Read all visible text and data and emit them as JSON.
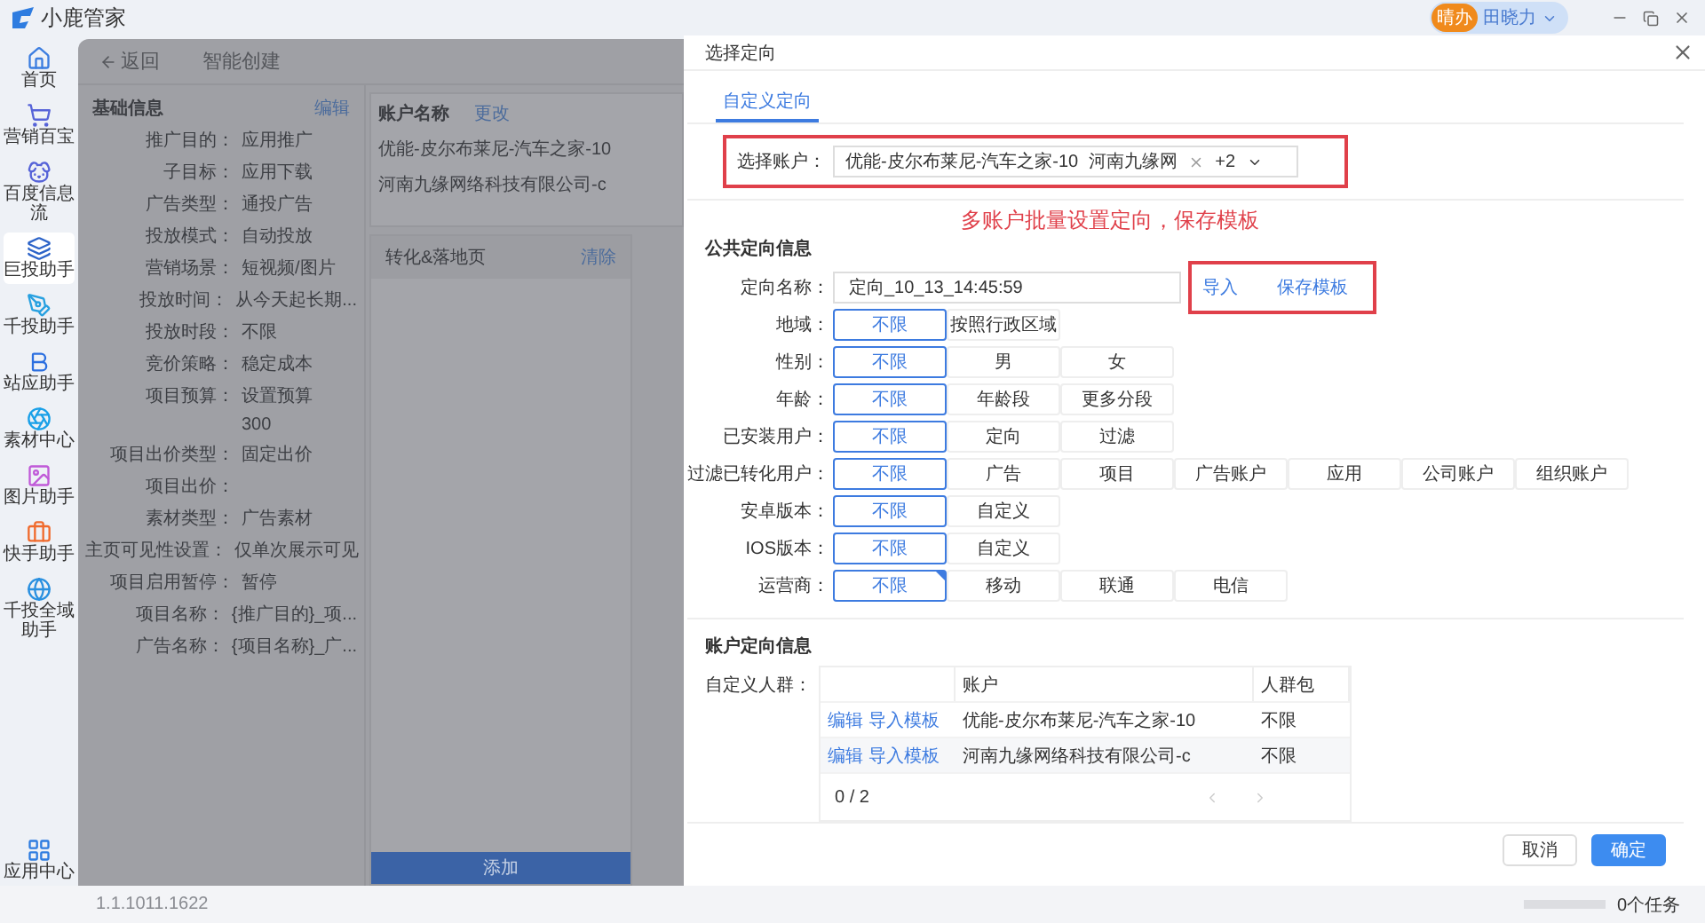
{
  "app": {
    "name": "小鹿管家",
    "user": {
      "avatar_text": "晴办",
      "name": "田晓力"
    }
  },
  "sidebar": {
    "items": [
      {
        "label": "首页",
        "selected": false
      },
      {
        "label": "营销百宝",
        "selected": false
      },
      {
        "label": "百度信息流",
        "selected": false
      },
      {
        "label": "巨投助手",
        "selected": true
      },
      {
        "label": "千投助手",
        "selected": false
      },
      {
        "label": "站应助手",
        "selected": false
      },
      {
        "label": "素材中心",
        "selected": false
      },
      {
        "label": "图片助手",
        "selected": false
      },
      {
        "label": "快手助手",
        "selected": false
      },
      {
        "label": "千投全域助手",
        "selected": false
      }
    ],
    "bottom_item": {
      "label": "应用中心"
    }
  },
  "background_page": {
    "back": "返回",
    "title": "智能创建",
    "basic_info": {
      "title": "基础信息",
      "action": "编辑",
      "rows": [
        {
          "label": "推广目的：",
          "value": "应用推广"
        },
        {
          "label": "子目标：",
          "value": "应用下载"
        },
        {
          "label": "广告类型：",
          "value": "通投广告"
        },
        {
          "label": "投放模式：",
          "value": "自动投放"
        },
        {
          "label": "营销场景：",
          "value": "短视频/图片"
        },
        {
          "label": "投放时间：",
          "value": "从今天起长期..."
        },
        {
          "label": "投放时段：",
          "value": "不限"
        },
        {
          "label": "竞价策略：",
          "value": "稳定成本"
        },
        {
          "label": "项目预算：",
          "value": "设置预算"
        },
        {
          "value": "300"
        },
        {
          "label": "项目出价类型：",
          "value": "固定出价"
        },
        {
          "label": "项目出价："
        },
        {
          "label": "素材类型：",
          "value": "广告素材"
        },
        {
          "label": "主页可见性设置：",
          "value": "仅单次展示可见"
        },
        {
          "label": "项目启用暂停：",
          "value": "暂停"
        },
        {
          "label": "项目名称：",
          "value": "{推广目的}_项..."
        },
        {
          "label": "广告名称：",
          "value": "{项目名称}_广..."
        }
      ]
    },
    "accounts": {
      "title": "账户名称",
      "action": "更改",
      "items": [
        "优能-皮尔布莱尼-汽车之家-10",
        "河南九缘网络科技有限公司-c"
      ]
    },
    "landing_card": {
      "title": "转化&落地页",
      "action": "清除",
      "button": "添加"
    },
    "version": "1.1.1011.1622"
  },
  "drawer": {
    "title": "选择定向",
    "tabs": [
      {
        "label": "自定义定向",
        "selected": true
      }
    ],
    "account_select": {
      "label": "选择账户：",
      "tags": [
        "优能-皮尔布莱尼-汽车之家-10",
        "河南九缘网"
      ],
      "more": "+2",
      "highlighted": true
    },
    "annotation": "多账户批量设置定向，保存模板",
    "public_section": {
      "title": "公共定向信息",
      "name_field": {
        "label": "定向名称：",
        "value": "定向_10_13_14:45:59"
      },
      "template_actions": {
        "links": [
          "导入",
          "保存模板"
        ],
        "highlighted": true
      },
      "groups": [
        {
          "label": "地域：",
          "corner_mark": false,
          "options": [
            {
              "label": "不限",
              "selected": true
            },
            {
              "label": "按照行政区域",
              "selected": false
            }
          ]
        },
        {
          "label": "性别：",
          "corner_mark": false,
          "options": [
            {
              "label": "不限",
              "selected": true
            },
            {
              "label": "男",
              "selected": false
            },
            {
              "label": "女",
              "selected": false
            }
          ]
        },
        {
          "label": "年龄：",
          "corner_mark": false,
          "options": [
            {
              "label": "不限",
              "selected": true
            },
            {
              "label": "年龄段",
              "selected": false
            },
            {
              "label": "更多分段",
              "selected": false
            }
          ]
        },
        {
          "label": "已安装用户：",
          "corner_mark": false,
          "options": [
            {
              "label": "不限",
              "selected": true
            },
            {
              "label": "定向",
              "selected": false
            },
            {
              "label": "过滤",
              "selected": false
            }
          ]
        },
        {
          "label": "过滤已转化用户：",
          "corner_mark": false,
          "options": [
            {
              "label": "不限",
              "selected": true
            },
            {
              "label": "广告",
              "selected": false
            },
            {
              "label": "项目",
              "selected": false
            },
            {
              "label": "广告账户",
              "selected": false
            },
            {
              "label": "应用",
              "selected": false
            },
            {
              "label": "公司账户",
              "selected": false
            },
            {
              "label": "组织账户",
              "selected": false
            }
          ]
        },
        {
          "label": "安卓版本：",
          "corner_mark": false,
          "options": [
            {
              "label": "不限",
              "selected": true
            },
            {
              "label": "自定义",
              "selected": false
            }
          ]
        },
        {
          "label": "IOS版本：",
          "corner_mark": false,
          "options": [
            {
              "label": "不限",
              "selected": true
            },
            {
              "label": "自定义",
              "selected": false
            }
          ]
        },
        {
          "label": "运营商：",
          "corner_mark": true,
          "options": [
            {
              "label": "不限",
              "selected": true
            },
            {
              "label": "移动",
              "selected": false
            },
            {
              "label": "联通",
              "selected": false
            },
            {
              "label": "电信",
              "selected": false
            }
          ]
        }
      ]
    },
    "account_section": {
      "title": "账户定向信息",
      "label": "自定义人群：",
      "columns": [
        "账户",
        "人群包"
      ],
      "rows": [
        {
          "actions": [
            "编辑",
            "导入模板"
          ],
          "account": "优能-皮尔布莱尼-汽车之家-10",
          "audience": "不限"
        },
        {
          "actions": [
            "编辑",
            "导入模板"
          ],
          "account": "河南九缘网络科技有限公司-c",
          "audience": "不限"
        }
      ],
      "pagination": "0 / 2"
    },
    "buttons": [
      {
        "label": "取消",
        "primary": false
      },
      {
        "label": "确定",
        "primary": true
      }
    ]
  },
  "status_bar": {
    "level": 0,
    "tasks": "0个任务"
  }
}
